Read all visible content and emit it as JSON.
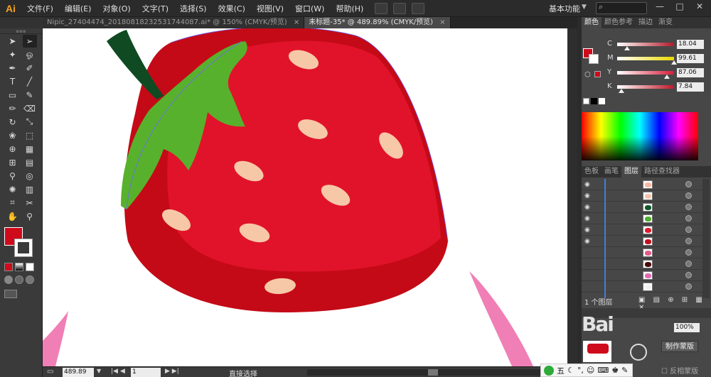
{
  "app": {
    "logo": "Ai",
    "workspace": "基本功能"
  },
  "menu": [
    "文件(F)",
    "编辑(E)",
    "对象(O)",
    "文字(T)",
    "选择(S)",
    "效果(C)",
    "视图(V)",
    "窗口(W)",
    "帮助(H)"
  ],
  "tabs": [
    {
      "label": "Nipic_27404474_20180818232531744087.ai* @ 150% (CMYK/预览)",
      "active": false
    },
    {
      "label": "未标题-35* @ 489.89% (CMYK/预览)",
      "active": true
    }
  ],
  "window": {
    "minimize": "—",
    "maximize": "□",
    "close": "✕"
  },
  "color_panel": {
    "tabs": [
      "颜色",
      "颜色参考",
      "描边",
      "渐变"
    ],
    "channels": [
      {
        "label": "C",
        "value": "18.04",
        "percent": 18.04,
        "color": "#b01a2a"
      },
      {
        "label": "M",
        "value": "99.61",
        "percent": 99.61,
        "color": "#e8d800"
      },
      {
        "label": "Y",
        "value": "87.06",
        "percent": 87.06,
        "color": "#d91a3a"
      },
      {
        "label": "K",
        "value": "7.84",
        "percent": 7.84,
        "color": "#c0182a"
      }
    ],
    "fill_color": "#cf0a1b"
  },
  "layers_panel": {
    "tabs": [
      "色板",
      "画笔",
      "图层",
      "路径查找器"
    ],
    "row_thumbs": [
      "#f7b7a0",
      "#f4c3ad",
      "#0f5a2a",
      "#4fae2e",
      "#e21a2a",
      "#c60f1f",
      "#e35d8a",
      "#4a0a0a",
      "#e36ab0",
      "#f0f0f0"
    ],
    "layer_count": "1 个图层",
    "mask_button": "制作蒙版",
    "invert_label": "反相蒙版",
    "opacity": "100%"
  },
  "status": {
    "zoom": "489.89",
    "artboard": "1",
    "tool": "直接选择"
  },
  "ime": {
    "label": "五"
  },
  "watermark": "Bai"
}
